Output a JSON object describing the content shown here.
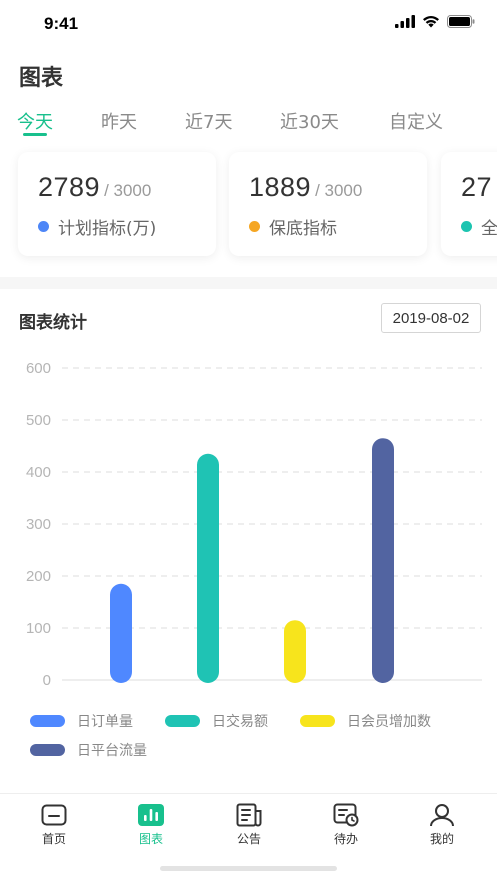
{
  "status_bar": {
    "time": "9:41"
  },
  "page": {
    "title": "图表"
  },
  "tabs": [
    {
      "label": "今天",
      "active": true
    },
    {
      "label": "昨天",
      "active": false
    },
    {
      "label": "近7天",
      "active": false
    },
    {
      "label": "近30天",
      "active": false
    },
    {
      "label": "自定义",
      "active": false
    }
  ],
  "cards": [
    {
      "value": "2789",
      "total": "/ 3000",
      "label": "计划指标(万)",
      "color": "#4d86f7"
    },
    {
      "value": "1889",
      "total": "/ 3000",
      "label": "保底指标",
      "color": "#f5a623"
    },
    {
      "value": "27",
      "total": "",
      "label": "全",
      "color": "#1cc4b0"
    }
  ],
  "stats": {
    "title": "图表统计",
    "date": "2019-08-02"
  },
  "chart_data": {
    "type": "bar",
    "ylim": [
      0,
      600
    ],
    "yticks": [
      "600",
      "500",
      "400",
      "300",
      "200",
      "100",
      "0"
    ],
    "grid": true,
    "legend_position": "bottom",
    "series": [
      {
        "name": "日订单量",
        "value": 185,
        "color": "#4f88ff"
      },
      {
        "name": "日交易额",
        "value": 435,
        "color": "#1fc3b4"
      },
      {
        "name": "日会员增加数",
        "value": 115,
        "color": "#f7e41c"
      },
      {
        "name": "日平台流量",
        "value": 465,
        "color": "#5264a1"
      }
    ]
  },
  "tabbar": [
    {
      "label": "首页",
      "icon": "home-icon",
      "active": false
    },
    {
      "label": "图表",
      "icon": "chart-icon",
      "active": true
    },
    {
      "label": "公告",
      "icon": "notice-icon",
      "active": false
    },
    {
      "label": "待办",
      "icon": "todo-icon",
      "active": false
    },
    {
      "label": "我的",
      "icon": "user-icon",
      "active": false
    }
  ],
  "colors": {
    "accent": "#18c08d",
    "text": "#333333",
    "muted": "#8a8a8a"
  }
}
